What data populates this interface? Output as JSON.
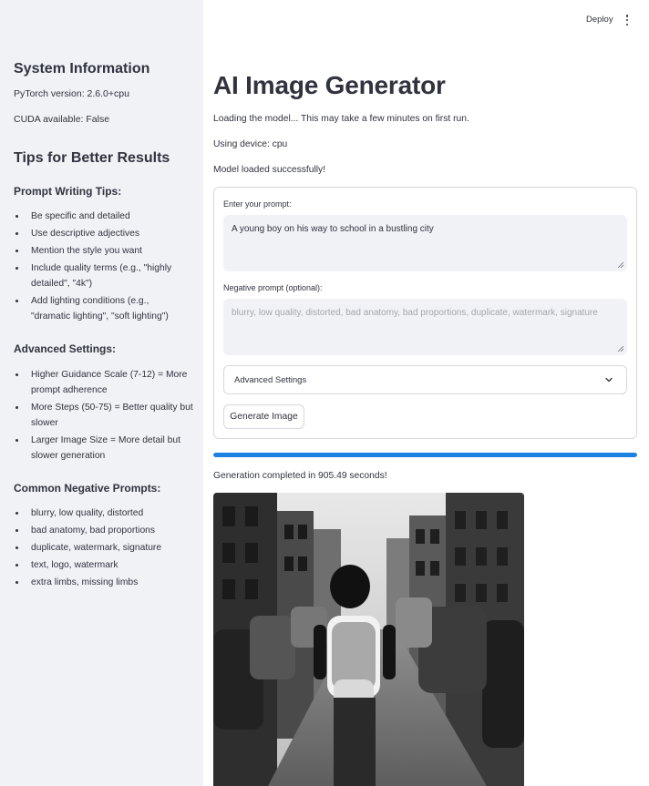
{
  "sidebar": {
    "system_title": "System Information",
    "pytorch_version": "PyTorch version: 2.6.0+cpu",
    "cuda_available": "CUDA available: False",
    "tips_title": "Tips for Better Results",
    "prompt_tips_heading": "Prompt Writing Tips:",
    "prompt_tips": [
      "Be specific and detailed",
      "Use descriptive adjectives",
      "Mention the style you want",
      "Include quality terms (e.g., \"highly",
      "detailed\", \"4k\")",
      "Add lighting conditions (e.g.,",
      "\"dramatic lighting\", \"soft lighting\")"
    ],
    "advanced_heading": "Advanced Settings:",
    "advanced_tips": [
      "Higher Guidance Scale (7-12) = More",
      "prompt adherence",
      "More Steps (50-75) = Better quality but",
      "slower",
      "Larger Image Size = More detail but",
      "slower generation"
    ],
    "negative_heading": "Common Negative Prompts:",
    "negative_tips": [
      "blurry, low quality, distorted",
      "bad anatomy, bad proportions",
      "duplicate, watermark, signature",
      "text, logo, watermark",
      "extra limbs, missing limbs"
    ]
  },
  "header": {
    "deploy_label": "Deploy",
    "menu_icon": "kebab-menu-icon"
  },
  "main": {
    "title": "AI Image Generator",
    "loading_message": "Loading the model... This may take a few minutes on first run.",
    "device_message": "Using device: cpu",
    "loaded_message": "Model loaded successfully!",
    "prompt_label": "Enter your prompt:",
    "prompt_value": "A young boy on his way to school in a bustling city",
    "negative_label": "Negative prompt (optional):",
    "negative_placeholder": "blurry, low quality, distorted, bad anatomy, bad proportions, duplicate, watermark, signature",
    "advanced_settings_label": "Advanced Settings",
    "generate_button_label": "Generate Image",
    "progress_percent": 100,
    "completion_message": "Generation completed in 905.49 seconds!",
    "image_alt": "Generated image"
  },
  "colors": {
    "sidebar_bg": "#f0f2f6",
    "accent_progress": "#1c83e1",
    "text": "#31333f"
  }
}
